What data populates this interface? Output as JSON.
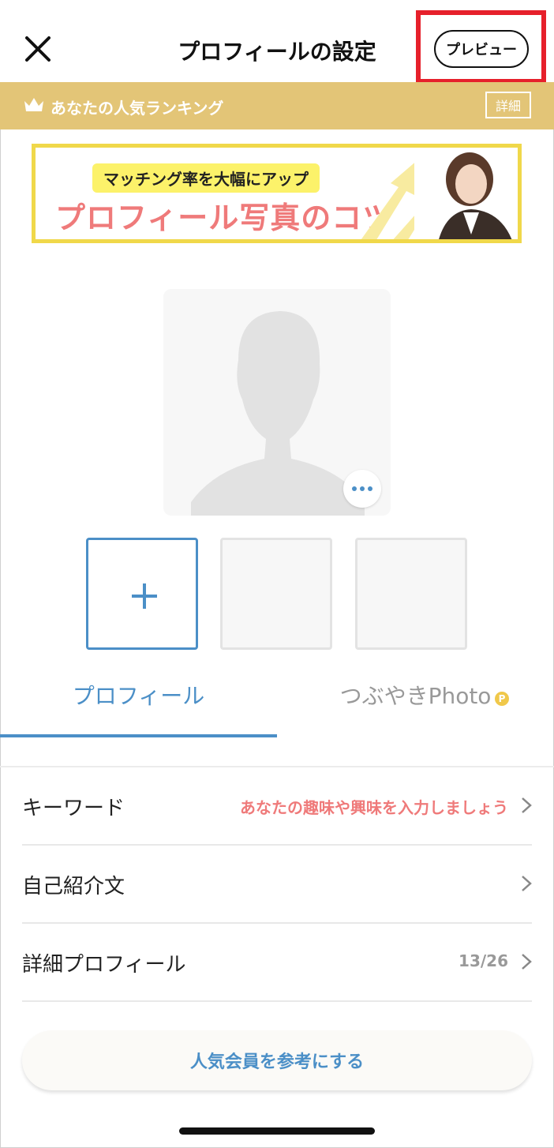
{
  "header": {
    "title": "プロフィールの設定",
    "preview_label": "プレビュー",
    "highlight_color": "#e6202b"
  },
  "ranking": {
    "label": "あなたの人気ランキング",
    "detail_label": "詳細",
    "bg_color": "#e3c577"
  },
  "banner": {
    "pill_text": "マッチング率を大幅にアップ",
    "title": "プロフィール写真のコツ"
  },
  "tabs": [
    {
      "label": "プロフィール",
      "active": true
    },
    {
      "label": "つぶやきPhoto",
      "active": false,
      "badge": "P"
    }
  ],
  "list": [
    {
      "label": "キーワード",
      "value": "あなたの趣味や興味を入力しましょう",
      "value_color": "#ef7a7a"
    },
    {
      "label": "自己紹介文",
      "value": ""
    },
    {
      "label": "詳細プロフィール",
      "value": "13/26",
      "value_color": "#999999"
    }
  ],
  "popular_button": "人気会員を参考にする",
  "accent_color": "#4b8fc7",
  "icons": [
    "close-icon",
    "crown-icon",
    "more-icon",
    "plus-icon",
    "chevron-right-icon",
    "avatar-silhouette-icon"
  ]
}
